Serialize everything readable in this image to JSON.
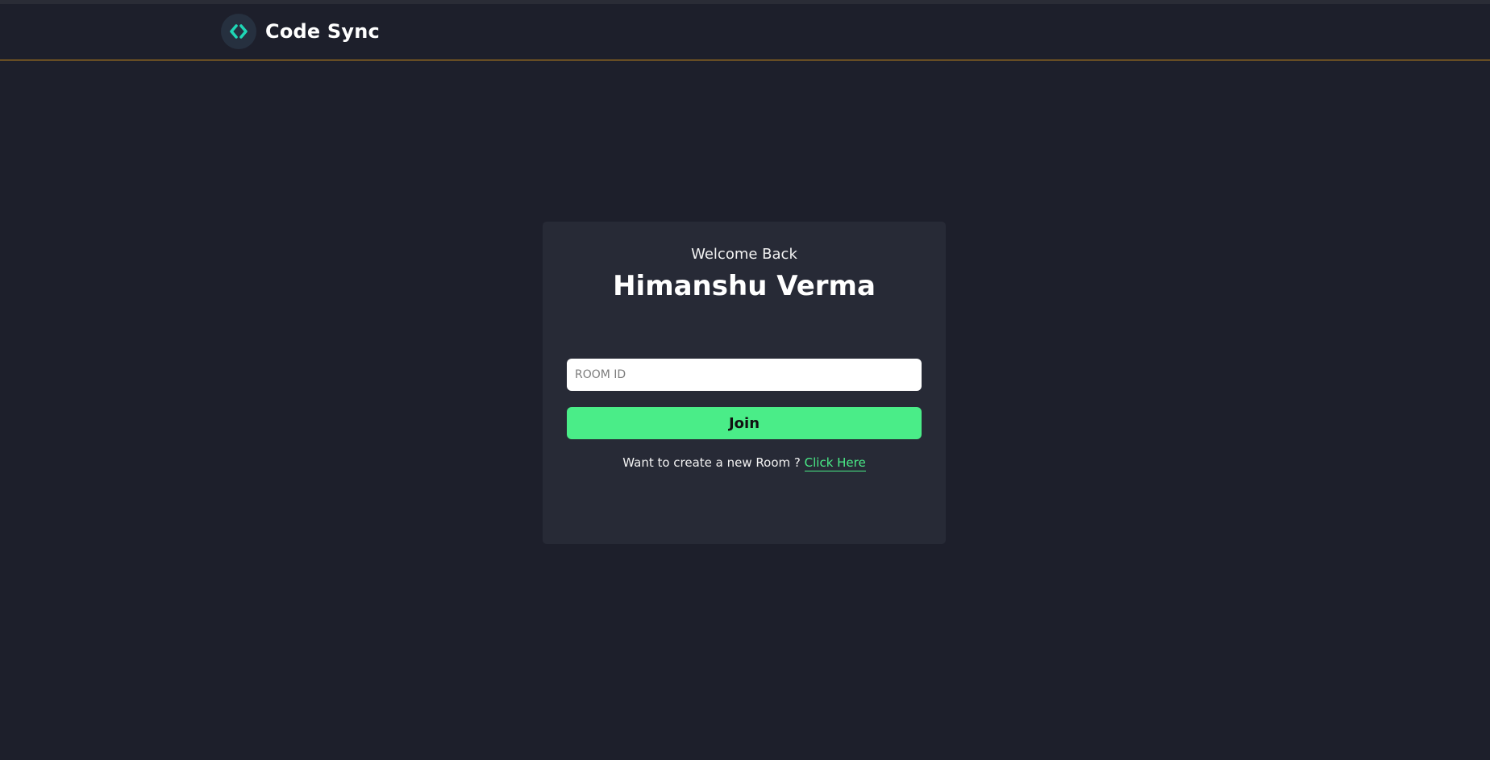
{
  "app": {
    "name": "Code Sync",
    "logo_icon": "code-brackets-icon",
    "header_border_color": "#c98a1a"
  },
  "login": {
    "greeting": "Welcome Back",
    "username": "Himanshu Verma",
    "room_id": {
      "value": "",
      "placeholder": "ROOM ID"
    },
    "join_label": "Join",
    "join_color": "#4aed88",
    "create_prompt": "Want to create a new Room ?",
    "create_link_label": "Click Here"
  }
}
